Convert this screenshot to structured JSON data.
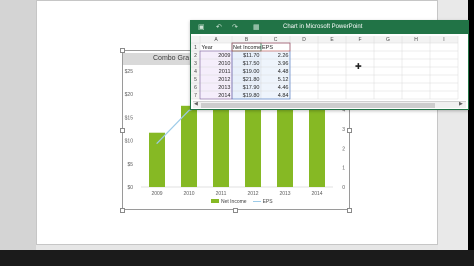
{
  "excel": {
    "title": "Chart in Microsoft PowerPoint",
    "columns": [
      "A",
      "B",
      "C",
      "D",
      "E",
      "F",
      "G",
      "H",
      "I"
    ],
    "rows": [
      {
        "num": "1",
        "a": "Year",
        "b": "Net Income",
        "c": "EPS"
      },
      {
        "num": "2",
        "a": "2009",
        "b": "$11.70",
        "c": "2.26"
      },
      {
        "num": "3",
        "a": "2010",
        "b": "$17.50",
        "c": "3.96"
      },
      {
        "num": "4",
        "a": "2011",
        "b": "$19.00",
        "c": "4.48"
      },
      {
        "num": "5",
        "a": "2012",
        "b": "$21.80",
        "c": "5.12"
      },
      {
        "num": "6",
        "a": "2013",
        "b": "$17.90",
        "c": "4.46"
      },
      {
        "num": "7",
        "a": "2014",
        "b": "$19.80",
        "c": "4.84"
      }
    ]
  },
  "chart": {
    "title": "Combo Gra",
    "legend": {
      "bar": "Net Income",
      "line": "EPS"
    },
    "colors": {
      "bar": "#86b924",
      "line": "#9dcbe8"
    }
  },
  "chart_data": {
    "type": "bar",
    "categories": [
      "2009",
      "2010",
      "2011",
      "2012",
      "2013",
      "2014"
    ],
    "series": [
      {
        "name": "Net Income",
        "type": "bar",
        "values": [
          11.7,
          17.5,
          19.0,
          21.8,
          17.9,
          19.8
        ]
      },
      {
        "name": "EPS",
        "type": "line",
        "values": [
          2.26,
          3.96,
          4.48,
          5.12,
          4.46,
          4.84
        ]
      }
    ],
    "y_ticks": [
      "$0",
      "$5",
      "$10",
      "$15",
      "$20",
      "$25"
    ],
    "y2_ticks": [
      "0",
      "1",
      "2",
      "3",
      "4",
      "5",
      "6"
    ],
    "ylim": [
      0,
      25
    ],
    "y2lim": [
      0,
      6
    ]
  }
}
